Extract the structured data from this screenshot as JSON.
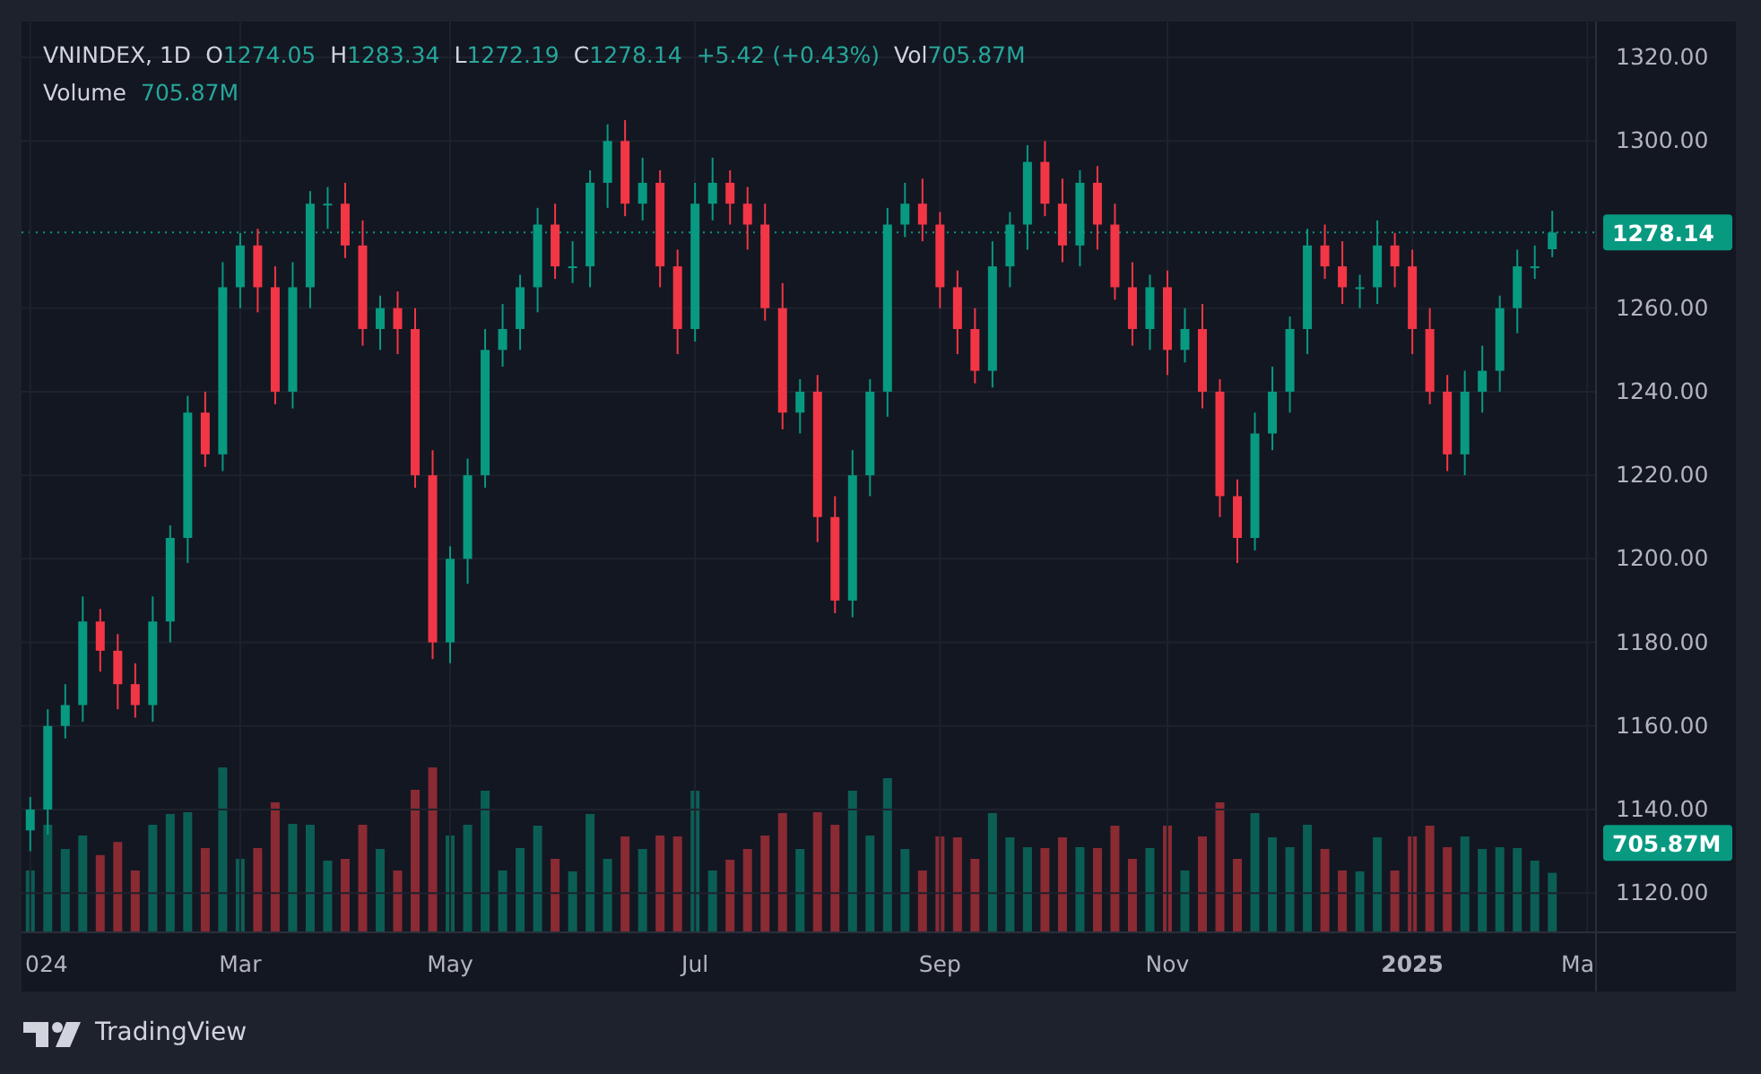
{
  "legend": {
    "symbol": "VNINDEX, 1D",
    "ohlc": [
      {
        "label": "O",
        "value": "1274.05"
      },
      {
        "label": "H",
        "value": "1283.34"
      },
      {
        "label": "L",
        "value": "1272.19"
      },
      {
        "label": "C",
        "value": "1278.14"
      }
    ],
    "change": "+5.42 (+0.43%)",
    "vol": {
      "label": "Vol",
      "value": "705.87M"
    }
  },
  "volume_legend": {
    "label": "Volume",
    "value": "705.87M"
  },
  "badges": {
    "last_price": "1278.14",
    "volume": "705.87M"
  },
  "chart_data": {
    "type": "candlestick",
    "grid": true,
    "ylim": [
      1110.6,
      1328.6
    ],
    "yticks": [
      {
        "value": 1120,
        "label": "1120.00"
      },
      {
        "value": 1140,
        "label": "1140.00"
      },
      {
        "value": 1160,
        "label": "1160.00"
      },
      {
        "value": 1180,
        "label": "1180.00"
      },
      {
        "value": 1200,
        "label": "1200.00"
      },
      {
        "value": 1220,
        "label": "1220.00"
      },
      {
        "value": 1240,
        "label": "1240.00"
      },
      {
        "value": 1260,
        "label": "1260.00"
      },
      {
        "value": 1300,
        "label": "1300.00"
      },
      {
        "value": 1320,
        "label": "1320.00"
      }
    ],
    "categories": [
      "024",
      null,
      null,
      null,
      null,
      null,
      null,
      null,
      null,
      null,
      null,
      null,
      "Mar",
      null,
      null,
      null,
      null,
      null,
      null,
      null,
      null,
      null,
      null,
      null,
      "May",
      null,
      null,
      null,
      null,
      null,
      null,
      null,
      null,
      null,
      null,
      null,
      null,
      null,
      "Jul",
      null,
      null,
      null,
      null,
      null,
      null,
      null,
      null,
      null,
      null,
      null,
      null,
      null,
      "Sep",
      null,
      null,
      null,
      null,
      null,
      null,
      null,
      null,
      null,
      null,
      null,
      null,
      "Nov",
      null,
      null,
      null,
      null,
      null,
      null,
      null,
      null,
      null,
      null,
      null,
      null,
      null,
      "2025",
      null,
      null,
      null,
      null,
      null,
      null,
      null,
      null,
      null,
      "Ma"
    ],
    "ohlc": [
      [
        1135,
        1143,
        1130,
        1140
      ],
      [
        1140,
        1164,
        1134,
        1160
      ],
      [
        1160,
        1170,
        1157,
        1165
      ],
      [
        1165,
        1191,
        1161,
        1185
      ],
      [
        1185,
        1188,
        1173,
        1178
      ],
      [
        1178,
        1182,
        1164,
        1170
      ],
      [
        1170,
        1175,
        1162,
        1165
      ],
      [
        1165,
        1191,
        1161,
        1185
      ],
      [
        1185,
        1208,
        1180,
        1205
      ],
      [
        1205,
        1239,
        1199,
        1235
      ],
      [
        1235,
        1240,
        1222,
        1225
      ],
      [
        1225,
        1271,
        1221,
        1265
      ],
      [
        1265,
        1278,
        1260,
        1275
      ],
      [
        1275,
        1279,
        1259,
        1265
      ],
      [
        1265,
        1270,
        1237,
        1240
      ],
      [
        1240,
        1271,
        1236,
        1265
      ],
      [
        1265,
        1288,
        1260,
        1285
      ],
      [
        1285,
        1289,
        1279,
        1285
      ],
      [
        1285,
        1290,
        1272,
        1275
      ],
      [
        1275,
        1281,
        1251,
        1255
      ],
      [
        1255,
        1263,
        1250,
        1260
      ],
      [
        1260,
        1264,
        1249,
        1255
      ],
      [
        1255,
        1260,
        1217,
        1220
      ],
      [
        1220,
        1226,
        1176,
        1180
      ],
      [
        1180,
        1203,
        1175,
        1200
      ],
      [
        1200,
        1224,
        1194,
        1220
      ],
      [
        1220,
        1255,
        1217,
        1250
      ],
      [
        1250,
        1261,
        1246,
        1255
      ],
      [
        1255,
        1268,
        1250,
        1265
      ],
      [
        1265,
        1284,
        1259,
        1280
      ],
      [
        1280,
        1285,
        1267,
        1270
      ],
      [
        1270,
        1276,
        1266,
        1270
      ],
      [
        1270,
        1293,
        1265,
        1290
      ],
      [
        1290,
        1304,
        1284,
        1300
      ],
      [
        1300,
        1305,
        1282,
        1285
      ],
      [
        1285,
        1296,
        1281,
        1290
      ],
      [
        1290,
        1293,
        1265,
        1270
      ],
      [
        1270,
        1274,
        1249,
        1255
      ],
      [
        1255,
        1290,
        1252,
        1285
      ],
      [
        1285,
        1296,
        1281,
        1290
      ],
      [
        1290,
        1293,
        1280,
        1285
      ],
      [
        1285,
        1289,
        1274,
        1280
      ],
      [
        1280,
        1285,
        1257,
        1260
      ],
      [
        1260,
        1266,
        1231,
        1235
      ],
      [
        1235,
        1243,
        1230,
        1240
      ],
      [
        1240,
        1244,
        1204,
        1210
      ],
      [
        1210,
        1215,
        1187,
        1190
      ],
      [
        1190,
        1226,
        1186,
        1220
      ],
      [
        1220,
        1243,
        1215,
        1240
      ],
      [
        1240,
        1284,
        1234,
        1280
      ],
      [
        1280,
        1290,
        1277,
        1285
      ],
      [
        1285,
        1291,
        1276,
        1280
      ],
      [
        1280,
        1283,
        1260,
        1265
      ],
      [
        1265,
        1269,
        1249,
        1255
      ],
      [
        1255,
        1260,
        1242,
        1245
      ],
      [
        1245,
        1276,
        1241,
        1270
      ],
      [
        1270,
        1283,
        1265,
        1280
      ],
      [
        1280,
        1299,
        1274,
        1295
      ],
      [
        1295,
        1300,
        1282,
        1285
      ],
      [
        1285,
        1291,
        1271,
        1275
      ],
      [
        1275,
        1293,
        1270,
        1290
      ],
      [
        1290,
        1294,
        1274,
        1280
      ],
      [
        1280,
        1285,
        1262,
        1265
      ],
      [
        1265,
        1271,
        1251,
        1255
      ],
      [
        1255,
        1268,
        1250,
        1265
      ],
      [
        1265,
        1269,
        1244,
        1250
      ],
      [
        1250,
        1260,
        1247,
        1255
      ],
      [
        1255,
        1261,
        1236,
        1240
      ],
      [
        1240,
        1243,
        1210,
        1215
      ],
      [
        1215,
        1219,
        1199,
        1205
      ],
      [
        1205,
        1235,
        1202,
        1230
      ],
      [
        1230,
        1246,
        1226,
        1240
      ],
      [
        1240,
        1258,
        1235,
        1255
      ],
      [
        1255,
        1279,
        1249,
        1275
      ],
      [
        1275,
        1280,
        1267,
        1270
      ],
      [
        1270,
        1276,
        1261,
        1265
      ],
      [
        1265,
        1268,
        1260,
        1265
      ],
      [
        1265,
        1281,
        1261,
        1275
      ],
      [
        1275,
        1278,
        1265,
        1270
      ],
      [
        1270,
        1274,
        1249,
        1255
      ],
      [
        1255,
        1260,
        1237,
        1240
      ],
      [
        1240,
        1244,
        1221,
        1225
      ],
      [
        1225,
        1245,
        1220,
        1240
      ],
      [
        1240,
        1251,
        1235,
        1245
      ],
      [
        1245,
        1263,
        1240,
        1260
      ],
      [
        1260,
        1274,
        1254,
        1270
      ],
      [
        1270,
        1275,
        1267,
        1270
      ],
      [
        1274.1,
        1283.3,
        1272.2,
        1278.1
      ],
      null,
      null
    ]
  },
  "brand": "TradingView"
}
